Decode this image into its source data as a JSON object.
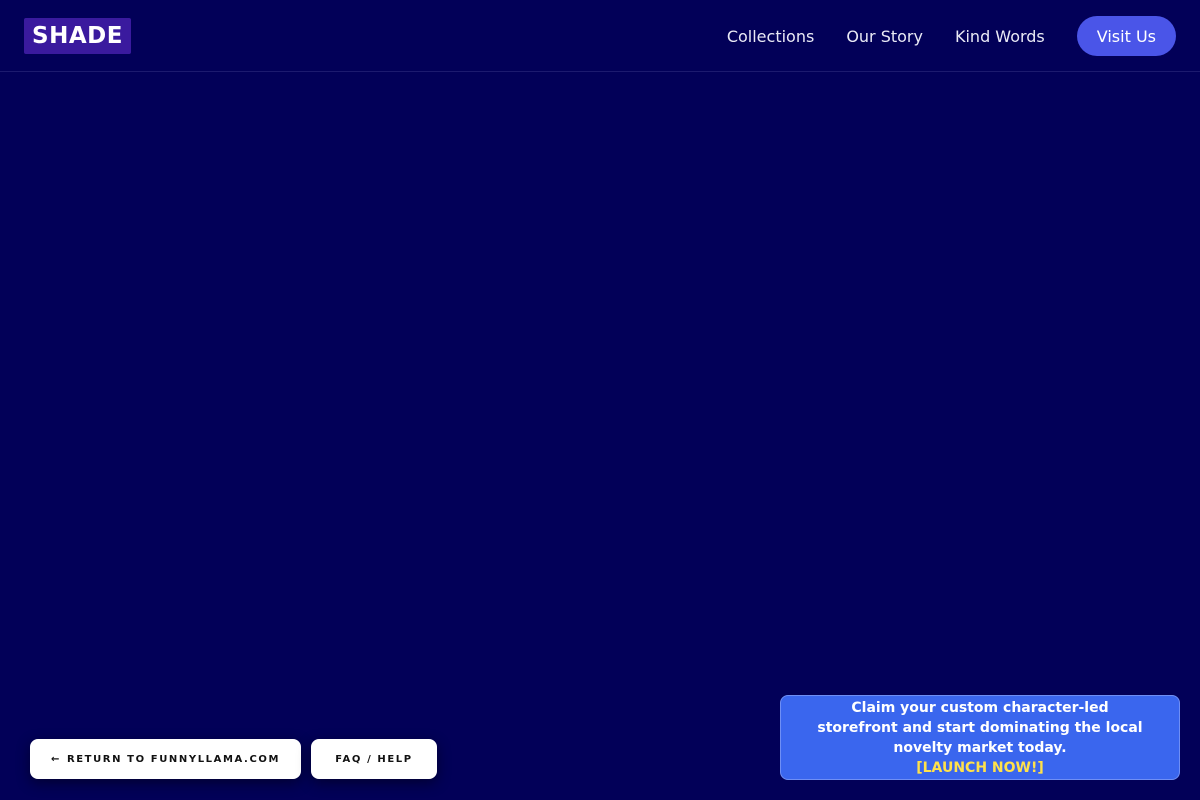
{
  "header": {
    "logo": "SHADE",
    "nav": [
      {
        "label": "Collections"
      },
      {
        "label": "Our Story"
      },
      {
        "label": "Kind Words"
      }
    ],
    "cta_label": "Visit Us"
  },
  "footer_buttons": {
    "return_arrow": "←",
    "return_label": "RETURN TO FUNNYLLAMA.COM",
    "faq_label": "FAQ / HELP"
  },
  "promo": {
    "text": "Claim your custom character-led storefront and start dominating the local novelty market today.",
    "cta": "[LAUNCH NOW!]"
  },
  "colors": {
    "background": "#020058",
    "logo_bg": "#3a1a9e",
    "cta_bg": "#4a55e8",
    "promo_bg": "#3a66ee",
    "promo_cta": "#ffe14a"
  }
}
